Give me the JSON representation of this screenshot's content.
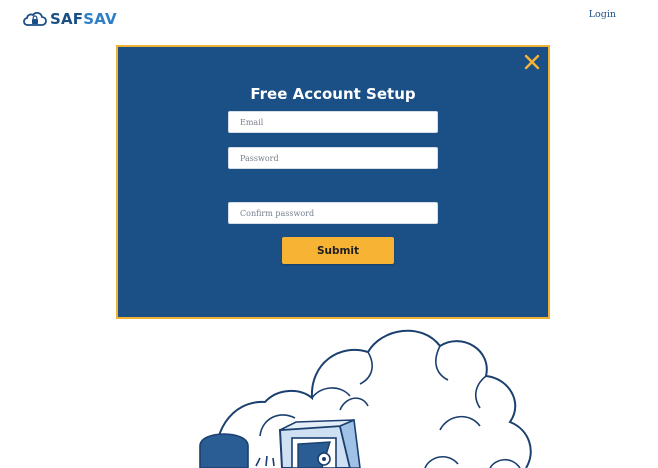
{
  "header": {
    "logo": {
      "part1": "SAF",
      "part2": "SAV",
      "icon": "cloud-lock-icon"
    },
    "login_label": "Login"
  },
  "modal": {
    "title": "Free Account Setup",
    "close_icon": "close-icon",
    "fields": {
      "email_placeholder": "Email",
      "password_placeholder": "Password",
      "confirm_placeholder": "Confirm password"
    },
    "submit_label": "Submit"
  },
  "illustration": {
    "icon": "cloud-safe-illustration"
  },
  "colors": {
    "brand_dark": "#1a4f86",
    "brand_light": "#2f7fc7",
    "modal_bg": "#1b5087",
    "accent": "#f7b334",
    "border_accent": "#f0b234"
  }
}
